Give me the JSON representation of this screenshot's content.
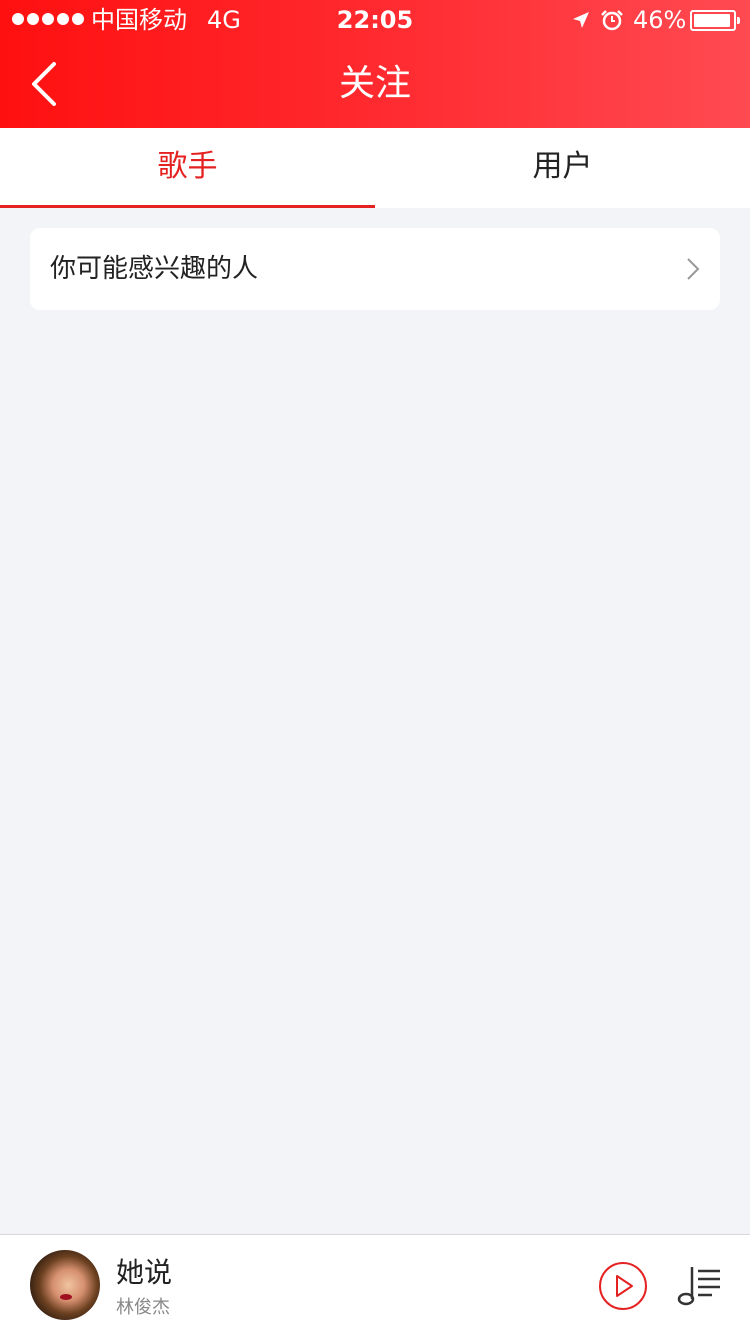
{
  "status_bar": {
    "carrier": "中国移动",
    "network": "4G",
    "time": "22:05",
    "battery_pct": "46%",
    "battery_level": 0.9
  },
  "nav": {
    "title": "关注"
  },
  "tabs": [
    {
      "label": "歌手",
      "active": true
    },
    {
      "label": "用户",
      "active": false
    }
  ],
  "card": {
    "label": "你可能感兴趣的人"
  },
  "player": {
    "song_title": "她说",
    "artist": "林俊杰"
  },
  "colors": {
    "brand_red": "#e52222",
    "background": "#f3f4f8"
  }
}
